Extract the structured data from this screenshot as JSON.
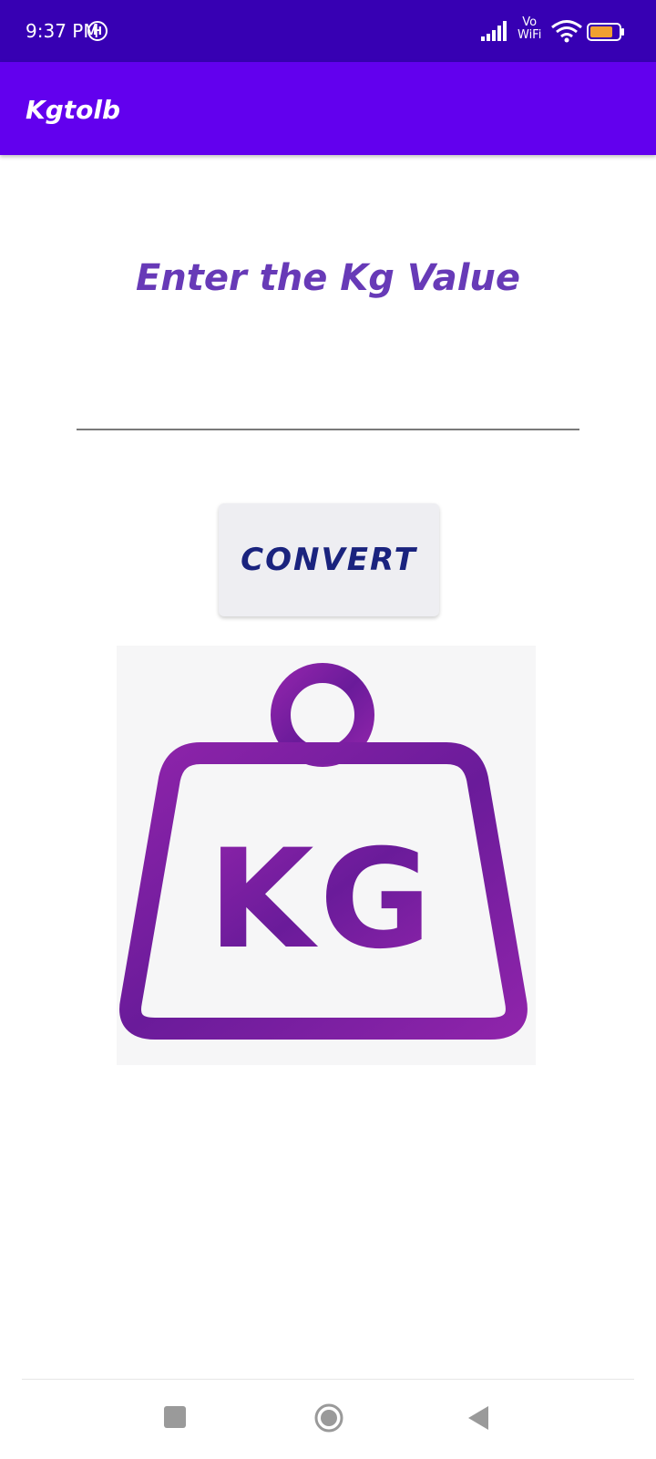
{
  "status_bar": {
    "time": "9:37 PM",
    "h_badge": "H",
    "network_label_top": "Vo",
    "network_label_bottom": "WiFi",
    "battery": "73"
  },
  "app_bar": {
    "title": "Kgtolb"
  },
  "main": {
    "heading": "Enter the Kg Value",
    "input_value": "",
    "convert_label": "CONVERT",
    "image_text": "KG"
  },
  "colors": {
    "status_bar": "#3700b3",
    "app_bar": "#6200ee",
    "heading": "#673ab7",
    "button_text": "#1a237e",
    "weight_icon": "#7b1fa2"
  },
  "nav_bar": {
    "icons": [
      "recent-apps-icon",
      "home-icon",
      "back-icon"
    ]
  }
}
